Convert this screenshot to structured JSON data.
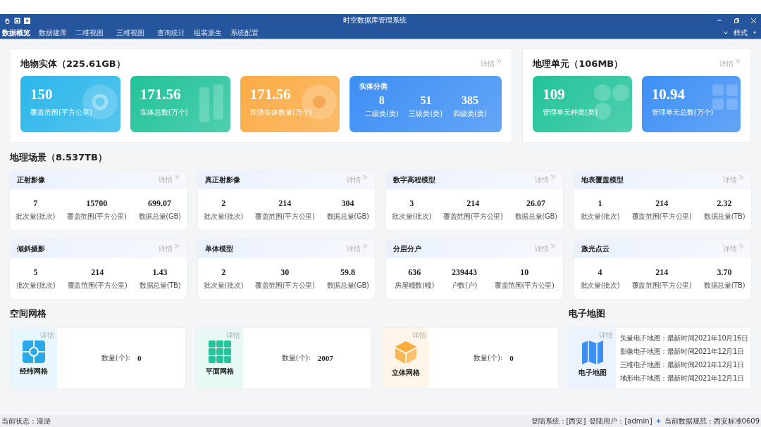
{
  "window": {
    "title": "时空数据库管理系统"
  },
  "menu": [
    {
      "label": "数据概览",
      "selected": true
    },
    {
      "label": "数据建库",
      "selected": false
    },
    {
      "label": "二维视图",
      "selected": false
    },
    {
      "label": "三维视图",
      "selected": false
    },
    {
      "label": "查询统计",
      "selected": false
    },
    {
      "label": "组装派生",
      "selected": false
    },
    {
      "label": "系统配置",
      "selected": false
    }
  ],
  "style_menu": {
    "label": "样式"
  },
  "entity": {
    "title": "地物实体（225.61GB）",
    "detail": "详情",
    "cards": [
      {
        "kind": "stat",
        "value": "150",
        "label": "覆盖范围(平方公里)",
        "color": "#2ab6ea"
      },
      {
        "kind": "stat",
        "value": "171.56",
        "label": "实体总数(万个)",
        "color": "#22c39a"
      },
      {
        "kind": "stat",
        "value": "171.56",
        "label": "现势实体数量(万个)",
        "color": "#fbab45"
      },
      {
        "kind": "group",
        "title": "实体分类",
        "color": "#3d8ff5",
        "items": [
          {
            "value": "8",
            "label": "二级类(类)"
          },
          {
            "value": "51",
            "label": "三级类(类)"
          },
          {
            "value": "385",
            "label": "四级类(类)"
          }
        ]
      }
    ]
  },
  "unit": {
    "title": "地理单元（106MB）",
    "detail": "详情",
    "cards": [
      {
        "kind": "stat",
        "value": "109",
        "label": "管理单元种类(类)",
        "color": "#22c39a"
      },
      {
        "kind": "stat",
        "value": "10.94",
        "label": "管理单元总数(万个)",
        "color": "#3d8ff5"
      }
    ]
  },
  "scene": {
    "title": "地理场景（8.537TB）",
    "cards": [
      {
        "title": "正射影像",
        "detail": "详情",
        "stats": [
          {
            "value": "7",
            "label": "批次量(批次)"
          },
          {
            "value": "15700",
            "label": "覆盖范围(平方公里)"
          },
          {
            "value": "699.07",
            "label": "数据总量(GB)"
          }
        ]
      },
      {
        "title": "真正射影像",
        "detail": "详情",
        "stats": [
          {
            "value": "2",
            "label": "批次量(批次)"
          },
          {
            "value": "214",
            "label": "覆盖范围(平方公里)"
          },
          {
            "value": "304",
            "label": "数据总量(GB)"
          }
        ]
      },
      {
        "title": "数字高程模型",
        "detail": "详情",
        "stats": [
          {
            "value": "3",
            "label": "批次量(批次)"
          },
          {
            "value": "214",
            "label": "覆盖范围(平方公里)"
          },
          {
            "value": "26.07",
            "label": "数据总量(GB)"
          }
        ]
      },
      {
        "title": "地表覆盖模型",
        "detail": "详情",
        "stats": [
          {
            "value": "1",
            "label": "批次量(批次)"
          },
          {
            "value": "214",
            "label": "覆盖范围(平方公里)"
          },
          {
            "value": "2.32",
            "label": "数据总量(TB)"
          }
        ]
      },
      {
        "title": "倾斜摄影",
        "detail": "详情",
        "stats": [
          {
            "value": "5",
            "label": "批次量(批次)"
          },
          {
            "value": "214",
            "label": "覆盖范围(平方公里)"
          },
          {
            "value": "1.43",
            "label": "数据总量(TB)"
          }
        ]
      },
      {
        "title": "单体模型",
        "detail": "详情",
        "stats": [
          {
            "value": "2",
            "label": "批次量(批次)"
          },
          {
            "value": "30",
            "label": "覆盖范围(平方公里)"
          },
          {
            "value": "59.8",
            "label": "数据总量(GB)"
          }
        ]
      },
      {
        "title": "分层分户",
        "detail": "详情",
        "stats": [
          {
            "value": "636",
            "label": "房屋幢数(幢)"
          },
          {
            "value": "239443",
            "label": "户数(户)"
          },
          {
            "value": "10",
            "label": "覆盖范围(平方公里)"
          }
        ]
      },
      {
        "title": "激光点云",
        "detail": "详情",
        "stats": [
          {
            "value": "4",
            "label": "批次量(批次)"
          },
          {
            "value": "214",
            "label": "覆盖范围(平方公里)"
          },
          {
            "value": "3.70",
            "label": "数据总量(TB)"
          }
        ]
      }
    ]
  },
  "grid": {
    "title": "空间网格",
    "cards": [
      {
        "kind": "latlon",
        "name": "经纬网格",
        "detail": "详情",
        "count_label": "数量(个):",
        "count": "0",
        "color": "#2aa9ea"
      },
      {
        "kind": "plane",
        "name": "平面网格",
        "detail": "详情",
        "count_label": "数量(个):",
        "count": "2007",
        "color": "#25c49a"
      },
      {
        "kind": "cube",
        "name": "立体网格",
        "detail": "详情",
        "count_label": "数量(个):",
        "count": "0",
        "color": "#fbab3a"
      }
    ]
  },
  "emap": {
    "title": "电子地图",
    "name": "电子地图",
    "detail": "详情",
    "color": "#3d8ff5",
    "lines": [
      "矢量电子地图：最新时间2021年10月16日",
      "影像电子地图：最新时间2021年12月1日",
      "三维电子地图：最新时间2021年12月1日",
      "地形电子地图：最新时间2021年12月1日"
    ]
  },
  "status_bar": {
    "state": "当前状态：漫游",
    "system": "登陆系统：[西安]",
    "user": "登陆用户：[admin]",
    "spec": "当前数据规范：西安标准0609"
  }
}
